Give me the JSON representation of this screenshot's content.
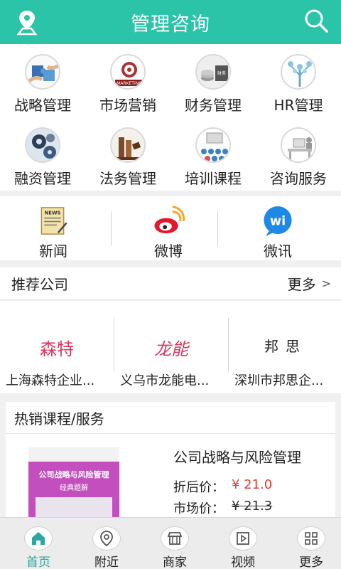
{
  "header": {
    "title": "管理咨询"
  },
  "categories": [
    {
      "label": "战略管理",
      "icon": "puzzle-hands-icon"
    },
    {
      "label": "市场营销",
      "icon": "marketing-target-icon"
    },
    {
      "label": "财务管理",
      "icon": "finance-coins-icon"
    },
    {
      "label": "HR管理",
      "icon": "hr-tree-icon"
    },
    {
      "label": "融资管理",
      "icon": "financing-gears-icon"
    },
    {
      "label": "法务管理",
      "icon": "law-gavel-icon"
    },
    {
      "label": "培训课程",
      "icon": "training-audience-icon"
    },
    {
      "label": "咨询服务",
      "icon": "consulting-desk-icon"
    }
  ],
  "social": [
    {
      "label": "新闻",
      "icon": "news-icon"
    },
    {
      "label": "微博",
      "icon": "weibo-icon"
    },
    {
      "label": "微讯",
      "icon": "wi-icon",
      "icon_text": "wi"
    }
  ],
  "recommend": {
    "title": "推荐公司",
    "more": "更多",
    "more_chevron": ">",
    "companies": [
      {
        "logo": "森特",
        "name": "上海森特企业...",
        "color": "#d8365e"
      },
      {
        "logo": "龙能",
        "name": "义乌市龙能电...",
        "color": "#d8365e"
      },
      {
        "logo": "邦思",
        "name": "深圳市邦思企...",
        "color": "#222222"
      }
    ]
  },
  "hot": {
    "title": "热销课程/服务",
    "product": {
      "title": "公司战略与风险管理",
      "cover_title": "公司战略与风险管理",
      "cover_subtitle": "经典题解",
      "discount_label": "折后价：",
      "discount_value": "¥ 21.0",
      "market_label": "市场价：",
      "market_value": "¥ 21.3"
    }
  },
  "tabbar": [
    {
      "label": "首页",
      "icon": "home-icon",
      "active": true
    },
    {
      "label": "附近",
      "icon": "location-pin-icon",
      "active": false
    },
    {
      "label": "商家",
      "icon": "store-icon",
      "active": false
    },
    {
      "label": "视频",
      "icon": "video-play-icon",
      "active": false
    },
    {
      "label": "更多",
      "icon": "grid-more-icon",
      "active": false
    }
  ],
  "colors": {
    "accent": "#2bc4a8",
    "price_red": "#e53935",
    "tab_active": "#2aa7a0"
  }
}
